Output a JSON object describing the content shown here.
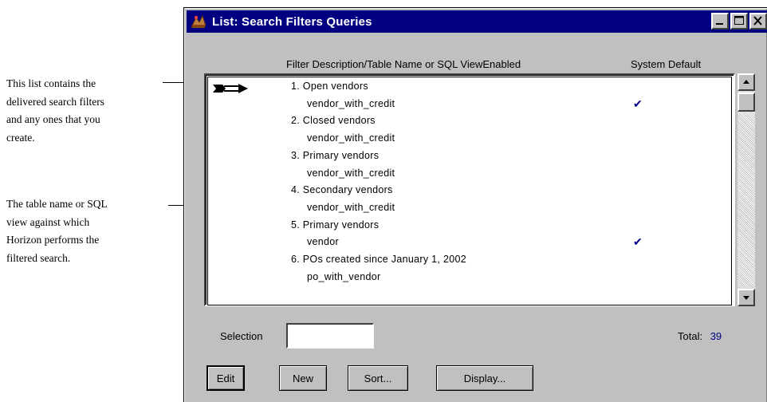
{
  "annotations": [
    {
      "text": "This list contains the\ndelivered search filters\nand any ones that you\ncreate."
    },
    {
      "text": "The table name or SQL\nview against which\nHorizon performs the\nfiltered search."
    }
  ],
  "window": {
    "title": "List: Search Filters Queries",
    "buttons": [
      "minimize",
      "maximize",
      "close"
    ]
  },
  "columns": {
    "description": "Filter Description/Table Name or SQL ViewEnabled",
    "system_default": "System Default"
  },
  "rows": [
    {
      "text": "1. Open vendors",
      "indent": false,
      "checked": false
    },
    {
      "text": "vendor_with_credit",
      "indent": true,
      "checked": true
    },
    {
      "text": "2. Closed vendors",
      "indent": false,
      "checked": false
    },
    {
      "text": "vendor_with_credit",
      "indent": true,
      "checked": false
    },
    {
      "text": "3. Primary vendors",
      "indent": false,
      "checked": false
    },
    {
      "text": "vendor_with_credit",
      "indent": true,
      "checked": false
    },
    {
      "text": "4. Secondary vendors",
      "indent": false,
      "checked": false
    },
    {
      "text": "vendor_with_credit",
      "indent": true,
      "checked": false
    },
    {
      "text": "5. Primary vendors",
      "indent": false,
      "checked": false
    },
    {
      "text": "vendor",
      "indent": true,
      "checked": true
    },
    {
      "text": "6. POs created since January 1, 2002",
      "indent": false,
      "checked": false
    },
    {
      "text": "po_with_vendor",
      "indent": true,
      "checked": false
    }
  ],
  "check_mark": "✔",
  "selection": {
    "label": "Selection",
    "value": ""
  },
  "total": {
    "label": "Total:",
    "value": "39"
  },
  "buttons": {
    "edit": "Edit",
    "new": "New",
    "sort": "Sort...",
    "display": "Display..."
  },
  "colors": {
    "title_bar": "#000080",
    "window": "#c0c0c0",
    "check": "#00008b",
    "total_value": "#000080"
  }
}
